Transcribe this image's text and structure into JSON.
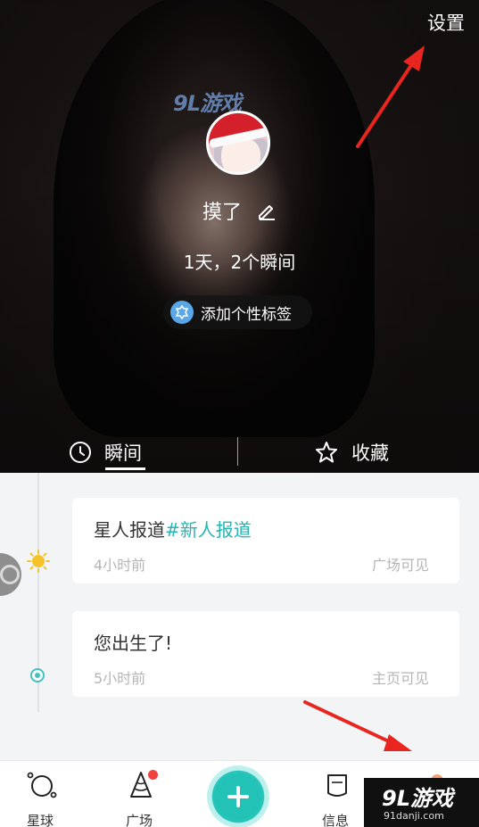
{
  "header": {
    "settings_label": "设置",
    "username": "摸了",
    "stats": "1天，2个瞬间",
    "tag_button_label": "添加个性标签",
    "watermark_text": "9L游戏"
  },
  "tabs": [
    {
      "label": "瞬间",
      "active": true
    },
    {
      "label": "收藏",
      "active": false
    }
  ],
  "feed": [
    {
      "title": "星人报道",
      "topic": "#新人报道",
      "time": "4小时前",
      "visibility": "广场可见"
    },
    {
      "title": "您出生了!",
      "topic": "",
      "time": "5小时前",
      "visibility": "主页可见"
    }
  ],
  "bottom_nav": {
    "planet": "星球",
    "plaza": "广场",
    "messages": "信息",
    "me": ""
  },
  "watermark": {
    "logo": "9L游戏",
    "site": "91danji.com"
  },
  "colors": {
    "accent": "#25b6b3",
    "arrow": "#e8251f",
    "badge": "#f0433f"
  }
}
